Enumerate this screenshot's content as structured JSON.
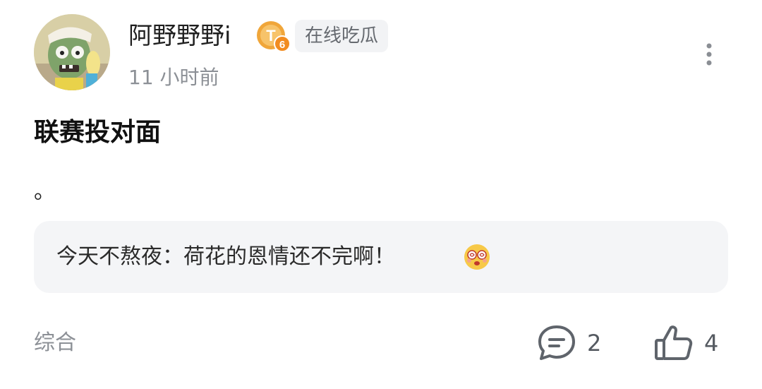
{
  "post": {
    "author": {
      "name": "阿野野野i",
      "avatar_icon": "zombie-avatar",
      "level_badge": "T6",
      "level_badge_color": "#f0a63a",
      "tag": "在线吃瓜"
    },
    "time": "11 小时前",
    "title": "联赛投对面",
    "body": "。",
    "featured_comment": {
      "author": "今天不熬夜",
      "separator": "：",
      "text": "荷花的恩情还不完啊！",
      "emoji_icon": "dizzy-eyes-emoji"
    },
    "category": "综合",
    "actions": {
      "comment_count": "2",
      "like_count": "4",
      "comment_icon": "comment-bubble-icon",
      "like_icon": "thumbs-up-icon",
      "more_icon": "more-vertical-icon"
    }
  }
}
